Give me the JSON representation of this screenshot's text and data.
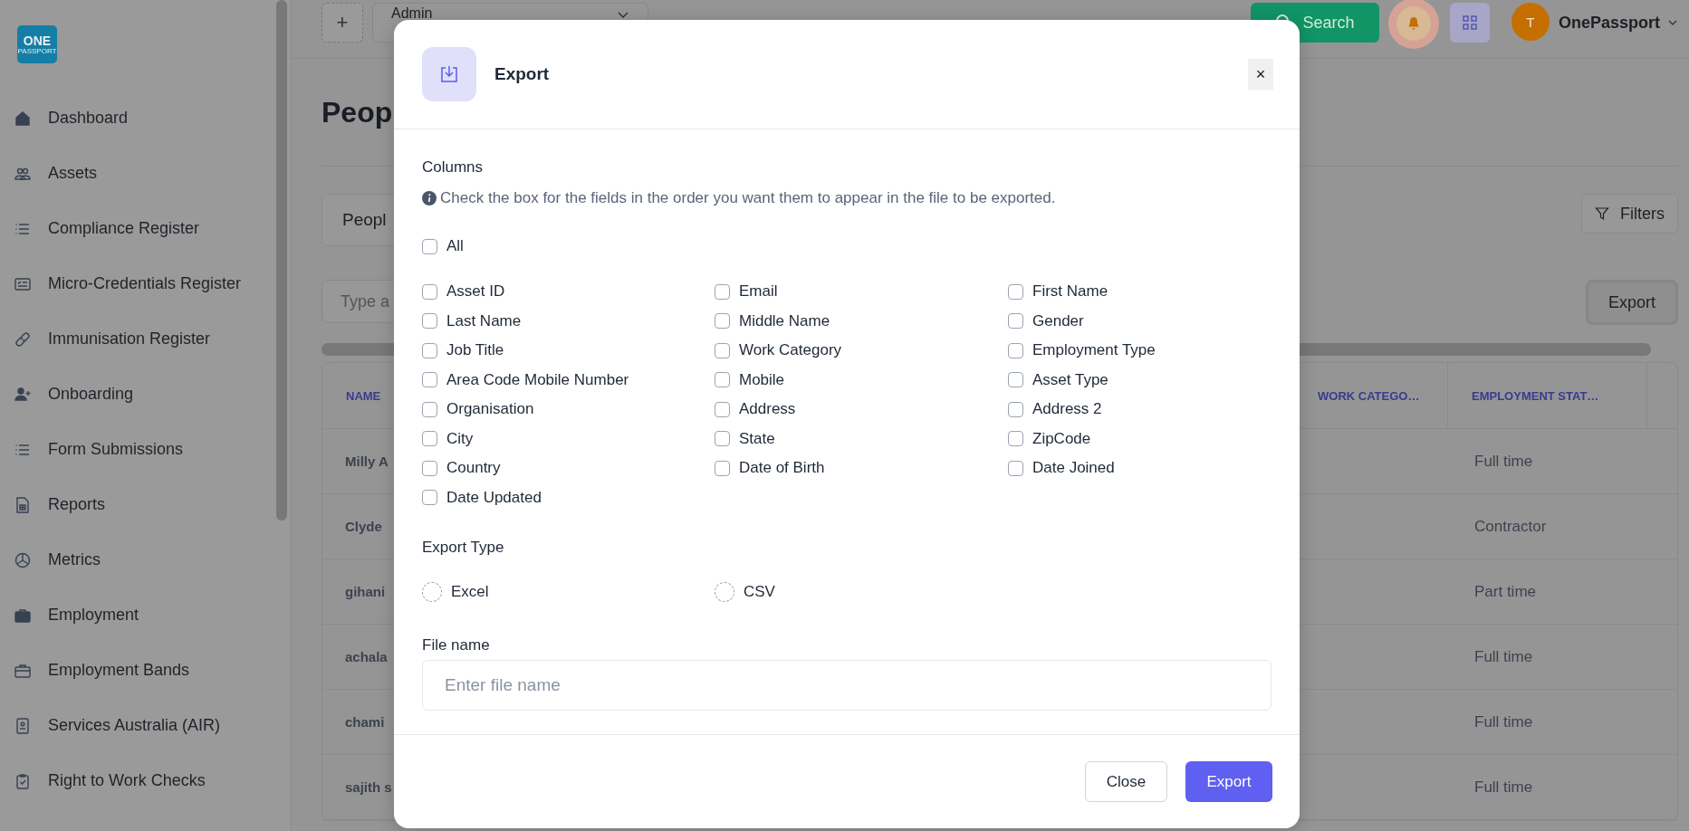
{
  "sidebar": {
    "logo": {
      "line1": "ONE",
      "line2": "PASSPORT"
    },
    "items": [
      {
        "label": "Dashboard",
        "kind": "home"
      },
      {
        "label": "Assets",
        "kind": "people"
      },
      {
        "label": "Compliance Register",
        "kind": "list"
      },
      {
        "label": "Micro-Credentials Register",
        "kind": "card"
      },
      {
        "label": "Immunisation Register",
        "kind": "bandage"
      },
      {
        "label": "Onboarding",
        "kind": "user-plus"
      },
      {
        "label": "Form Submissions",
        "kind": "list"
      },
      {
        "label": "Reports",
        "kind": "sheet"
      },
      {
        "label": "Metrics",
        "kind": "pie"
      },
      {
        "label": "Employment",
        "kind": "briefcase"
      },
      {
        "label": "Employment Bands",
        "kind": "briefcase-outline"
      },
      {
        "label": "Services Australia (AIR)",
        "kind": "badge"
      },
      {
        "label": "Right to Work Checks",
        "kind": "clipboard"
      }
    ]
  },
  "topbar": {
    "add_button": "+",
    "role_select": "Admin",
    "search_button": "Search",
    "user": {
      "initial": "T",
      "name": "OnePassport"
    }
  },
  "page": {
    "title": "Peop",
    "view_tab": "Peopl",
    "filters_button": "Filters",
    "search_placeholder": "Type a",
    "export_button": "Export"
  },
  "table": {
    "columns": [
      "NAME",
      "WORK CATEGO…",
      "EMPLOYMENT STAT…"
    ],
    "rows": [
      {
        "name": "Milly A",
        "status": "Full time"
      },
      {
        "name": "Clyde",
        "status": "Contractor"
      },
      {
        "name": "gihani",
        "status": "Part time"
      },
      {
        "name": "achala",
        "status": "Full time"
      },
      {
        "name": "chami",
        "status": "Full time"
      },
      {
        "name": "sajith s",
        "status": "Full time"
      }
    ]
  },
  "modal": {
    "title": "Export",
    "close": "×",
    "columns_label": "Columns",
    "hint": "Check the box for the fields in the order you want them to appear in the file to be exported.",
    "all": {
      "label": "All",
      "checked": false
    },
    "fields": [
      {
        "label": "Asset ID",
        "checked": false
      },
      {
        "label": "Email",
        "checked": false
      },
      {
        "label": "First Name",
        "checked": false
      },
      {
        "label": "Last Name",
        "checked": false
      },
      {
        "label": "Middle Name",
        "checked": false
      },
      {
        "label": "Gender",
        "checked": false
      },
      {
        "label": "Job Title",
        "checked": false
      },
      {
        "label": "Work Category",
        "checked": false
      },
      {
        "label": "Employment Type",
        "checked": false
      },
      {
        "label": "Area Code Mobile Number",
        "checked": false
      },
      {
        "label": "Mobile",
        "checked": false
      },
      {
        "label": "Asset Type",
        "checked": false
      },
      {
        "label": "Organisation",
        "checked": false
      },
      {
        "label": "Address",
        "checked": false
      },
      {
        "label": "Address 2",
        "checked": false
      },
      {
        "label": "City",
        "checked": false
      },
      {
        "label": "State",
        "checked": false
      },
      {
        "label": "ZipCode",
        "checked": false
      },
      {
        "label": "Country",
        "checked": false
      },
      {
        "label": "Date of Birth",
        "checked": false
      },
      {
        "label": "Date Joined",
        "checked": false
      },
      {
        "label": "Date Updated",
        "checked": false
      }
    ],
    "export_type_label": "Export Type",
    "export_types": [
      {
        "label": "Excel",
        "selected": false
      },
      {
        "label": "CSV",
        "selected": false
      }
    ],
    "file_name_label": "File name",
    "file_name_placeholder": "Enter file name",
    "close_button": "Close",
    "export_button": "Export"
  }
}
